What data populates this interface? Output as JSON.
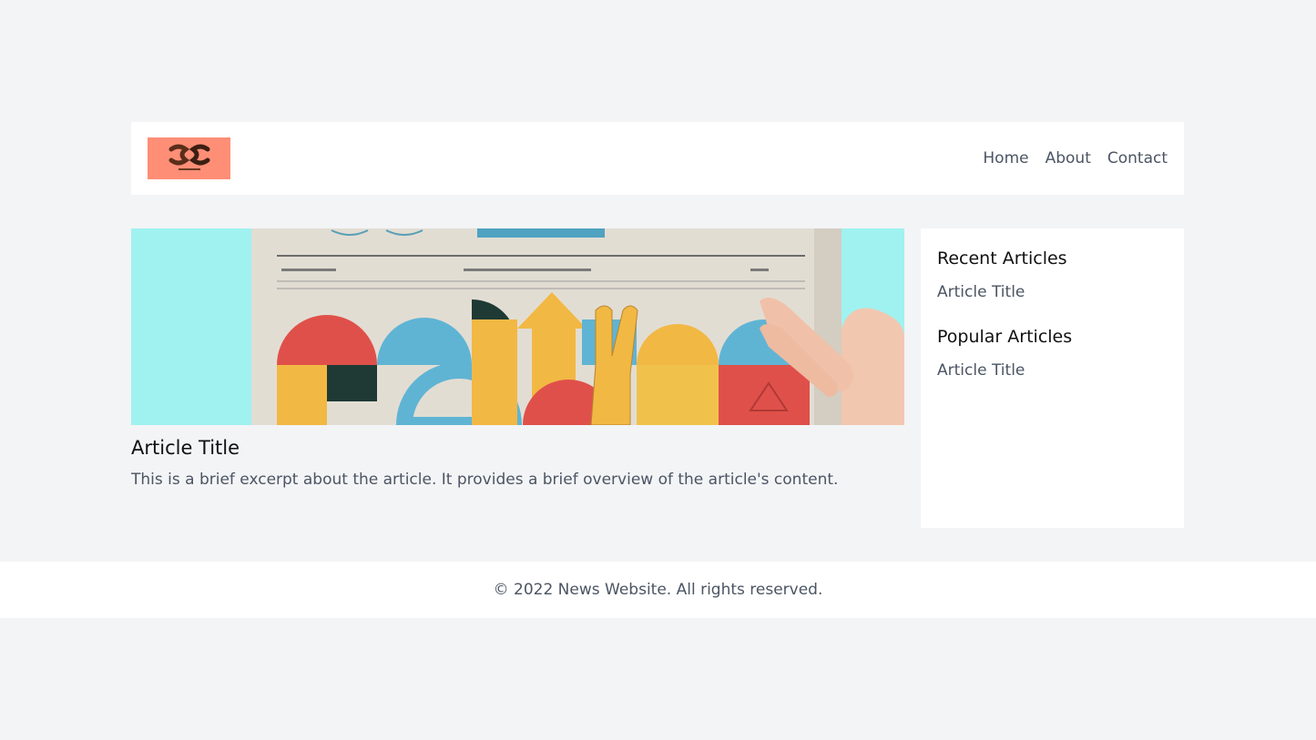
{
  "header": {
    "logo_icon": "scroll-logo-icon",
    "nav": [
      {
        "label": "Home"
      },
      {
        "label": "About"
      },
      {
        "label": "Contact"
      }
    ]
  },
  "main": {
    "hero_image": "newspaper-illustration",
    "article": {
      "title": "Article Title",
      "excerpt": "This is a brief excerpt about the article. It provides a brief overview of the article's content."
    }
  },
  "sidebar": {
    "sections": [
      {
        "heading": "Recent Articles",
        "items": [
          {
            "label": "Article Title"
          }
        ]
      },
      {
        "heading": "Popular Articles",
        "items": [
          {
            "label": "Article Title"
          }
        ]
      }
    ]
  },
  "footer": {
    "text": "© 2022 News Website. All rights reserved."
  },
  "colors": {
    "background": "#f3f4f6",
    "surface": "#ffffff",
    "logo_bg": "#ff8e77",
    "text": "#4b5563",
    "heading": "#111111"
  }
}
